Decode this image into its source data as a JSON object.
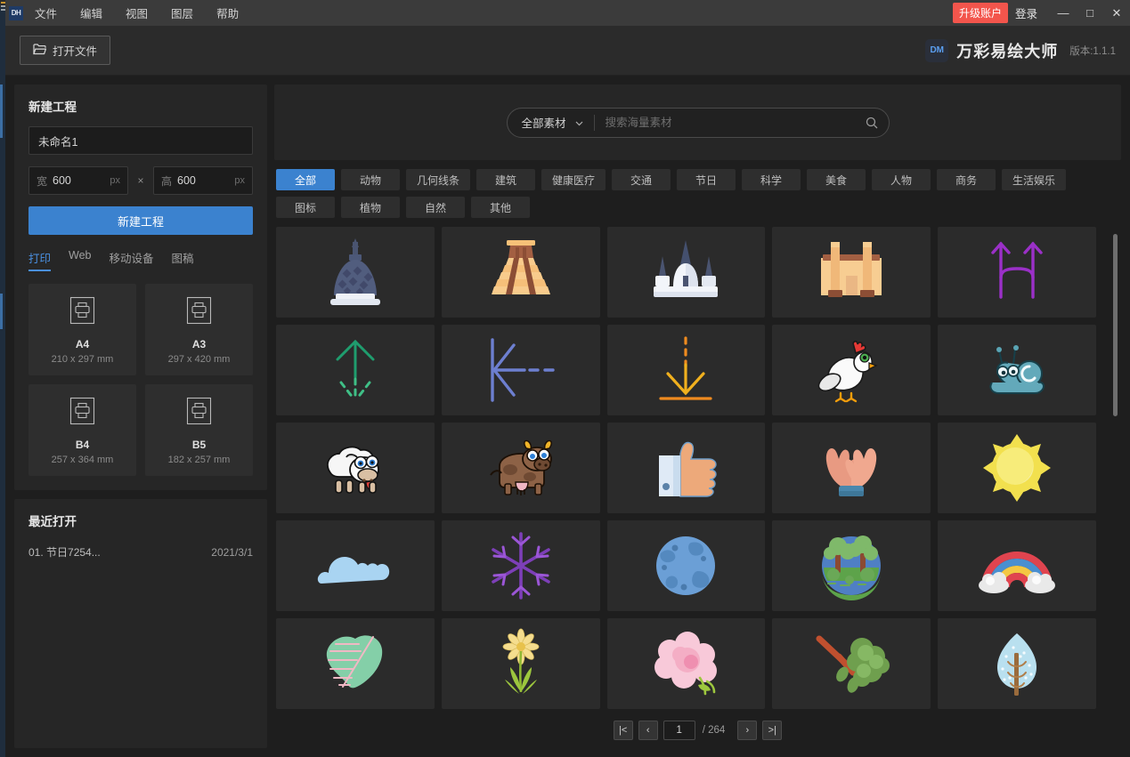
{
  "window": {
    "logo_text": "DH",
    "menus": [
      "文件",
      "编辑",
      "视图",
      "图层",
      "帮助"
    ],
    "upgrade_label": "升级账户",
    "login_label": "登录",
    "minimize_glyph": "—",
    "maximize_glyph": "□",
    "close_glyph": "✕",
    "accent_color": "#3b82cf",
    "upgrade_color": "#f3554c"
  },
  "toolbar": {
    "open_file_label": "打开文件",
    "brand_badge": "DM",
    "brand_name": "万彩易绘大师",
    "version": "版本:1.1.1"
  },
  "new_project": {
    "title": "新建工程",
    "name_value": "未命名1",
    "name_placeholder": "未命名1",
    "width_label": "宽",
    "width_value": "600",
    "height_label": "高",
    "height_value": "600",
    "unit": "px",
    "times_glyph": "×",
    "create_label": "新建工程",
    "tabs": [
      {
        "label": "打印",
        "active": true
      },
      {
        "label": "Web",
        "active": false
      },
      {
        "label": "移动设备",
        "active": false
      },
      {
        "label": "图稿",
        "active": false
      }
    ],
    "presets": [
      {
        "name": "A4",
        "dims": "210 x 297 mm"
      },
      {
        "name": "A3",
        "dims": "297 x 420 mm"
      },
      {
        "name": "B4",
        "dims": "257 x 364 mm"
      },
      {
        "name": "B5",
        "dims": "182 x 257 mm"
      }
    ]
  },
  "recent": {
    "title": "最近打开",
    "items": [
      {
        "name": "01. 节日7254...",
        "date": "2021/3/1"
      }
    ]
  },
  "search": {
    "scope_label": "全部素材",
    "placeholder": "搜索海量素材",
    "value": ""
  },
  "categories": [
    {
      "label": "全部",
      "active": true
    },
    {
      "label": "动物",
      "active": false
    },
    {
      "label": "几何线条",
      "active": false
    },
    {
      "label": "建筑",
      "active": false
    },
    {
      "label": "健康医疗",
      "active": false
    },
    {
      "label": "交通",
      "active": false
    },
    {
      "label": "节日",
      "active": false
    },
    {
      "label": "科学",
      "active": false
    },
    {
      "label": "美食",
      "active": false
    },
    {
      "label": "人物",
      "active": false
    },
    {
      "label": "商务",
      "active": false
    },
    {
      "label": "生活娱乐",
      "active": false
    },
    {
      "label": "图标",
      "active": false
    },
    {
      "label": "植物",
      "active": false
    },
    {
      "label": "自然",
      "active": false
    },
    {
      "label": "其他",
      "active": false
    }
  ],
  "assets": [
    {
      "icon": "stupa-temple-icon"
    },
    {
      "icon": "mayan-pyramid-icon"
    },
    {
      "icon": "white-temple-icon"
    },
    {
      "icon": "egyptian-temple-icon"
    },
    {
      "icon": "purple-double-arrow-icon"
    },
    {
      "icon": "green-up-arrow-icon"
    },
    {
      "icon": "blue-left-arrow-icon"
    },
    {
      "icon": "orange-down-arrow-icon"
    },
    {
      "icon": "chicken-icon"
    },
    {
      "icon": "snail-icon"
    },
    {
      "icon": "sheep-icon"
    },
    {
      "icon": "cow-icon"
    },
    {
      "icon": "thumbs-up-icon"
    },
    {
      "icon": "cupped-hands-icon"
    },
    {
      "icon": "sun-icon"
    },
    {
      "icon": "cloud-icon"
    },
    {
      "icon": "purple-snowflake-icon"
    },
    {
      "icon": "planet-earth-icon"
    },
    {
      "icon": "forest-globe-icon"
    },
    {
      "icon": "rainbow-icon"
    },
    {
      "icon": "green-leaf-icon"
    },
    {
      "icon": "daisy-flower-icon"
    },
    {
      "icon": "pink-rose-icon"
    },
    {
      "icon": "tree-branch-icon"
    },
    {
      "icon": "winter-tree-icon"
    }
  ],
  "pagination": {
    "first_glyph": "|<",
    "prev_glyph": "‹",
    "page_value": "1",
    "total_label": "/ 264",
    "next_glyph": "›",
    "last_glyph": ">|"
  }
}
